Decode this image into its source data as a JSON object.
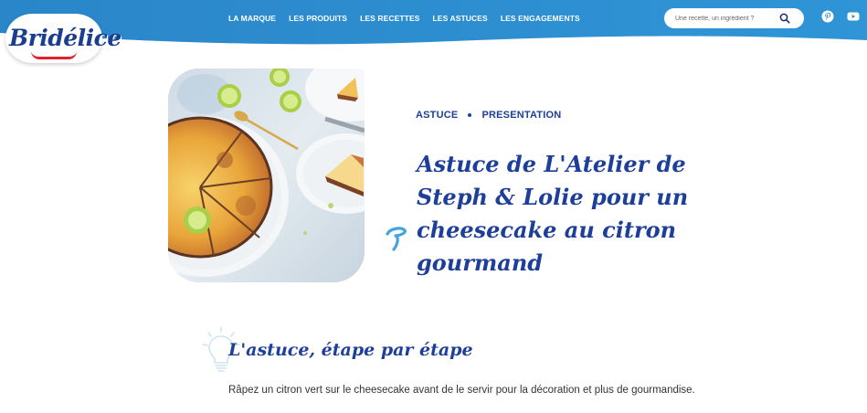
{
  "brand": {
    "logo_text": "Bridélice"
  },
  "nav": {
    "items": [
      "LA MARQUE",
      "LES PRODUITS",
      "LES RECETTES",
      "LES ASTUCES",
      "LES ENGAGEMENTS"
    ]
  },
  "search": {
    "placeholder": "Une recette, un ingrédient ?"
  },
  "social": {
    "icons": [
      "pinterest-icon",
      "youtube-icon"
    ]
  },
  "hero": {
    "tag_1": "ASTUCE",
    "tag_2": "PRESENTATION",
    "title": "Astuce de L'Atelier de Steph & Lolie pour un cheesecake au citron gourmand"
  },
  "section": {
    "title": "L'astuce, étape par étape",
    "text": "Râpez un citron vert sur le cheesecake avant de le servir pour la décoration et plus de gourmandise."
  },
  "colors": {
    "header_blue": "#2f8fcf",
    "title_blue": "#1d3f9a",
    "accent_light_blue": "#42a6dc"
  }
}
